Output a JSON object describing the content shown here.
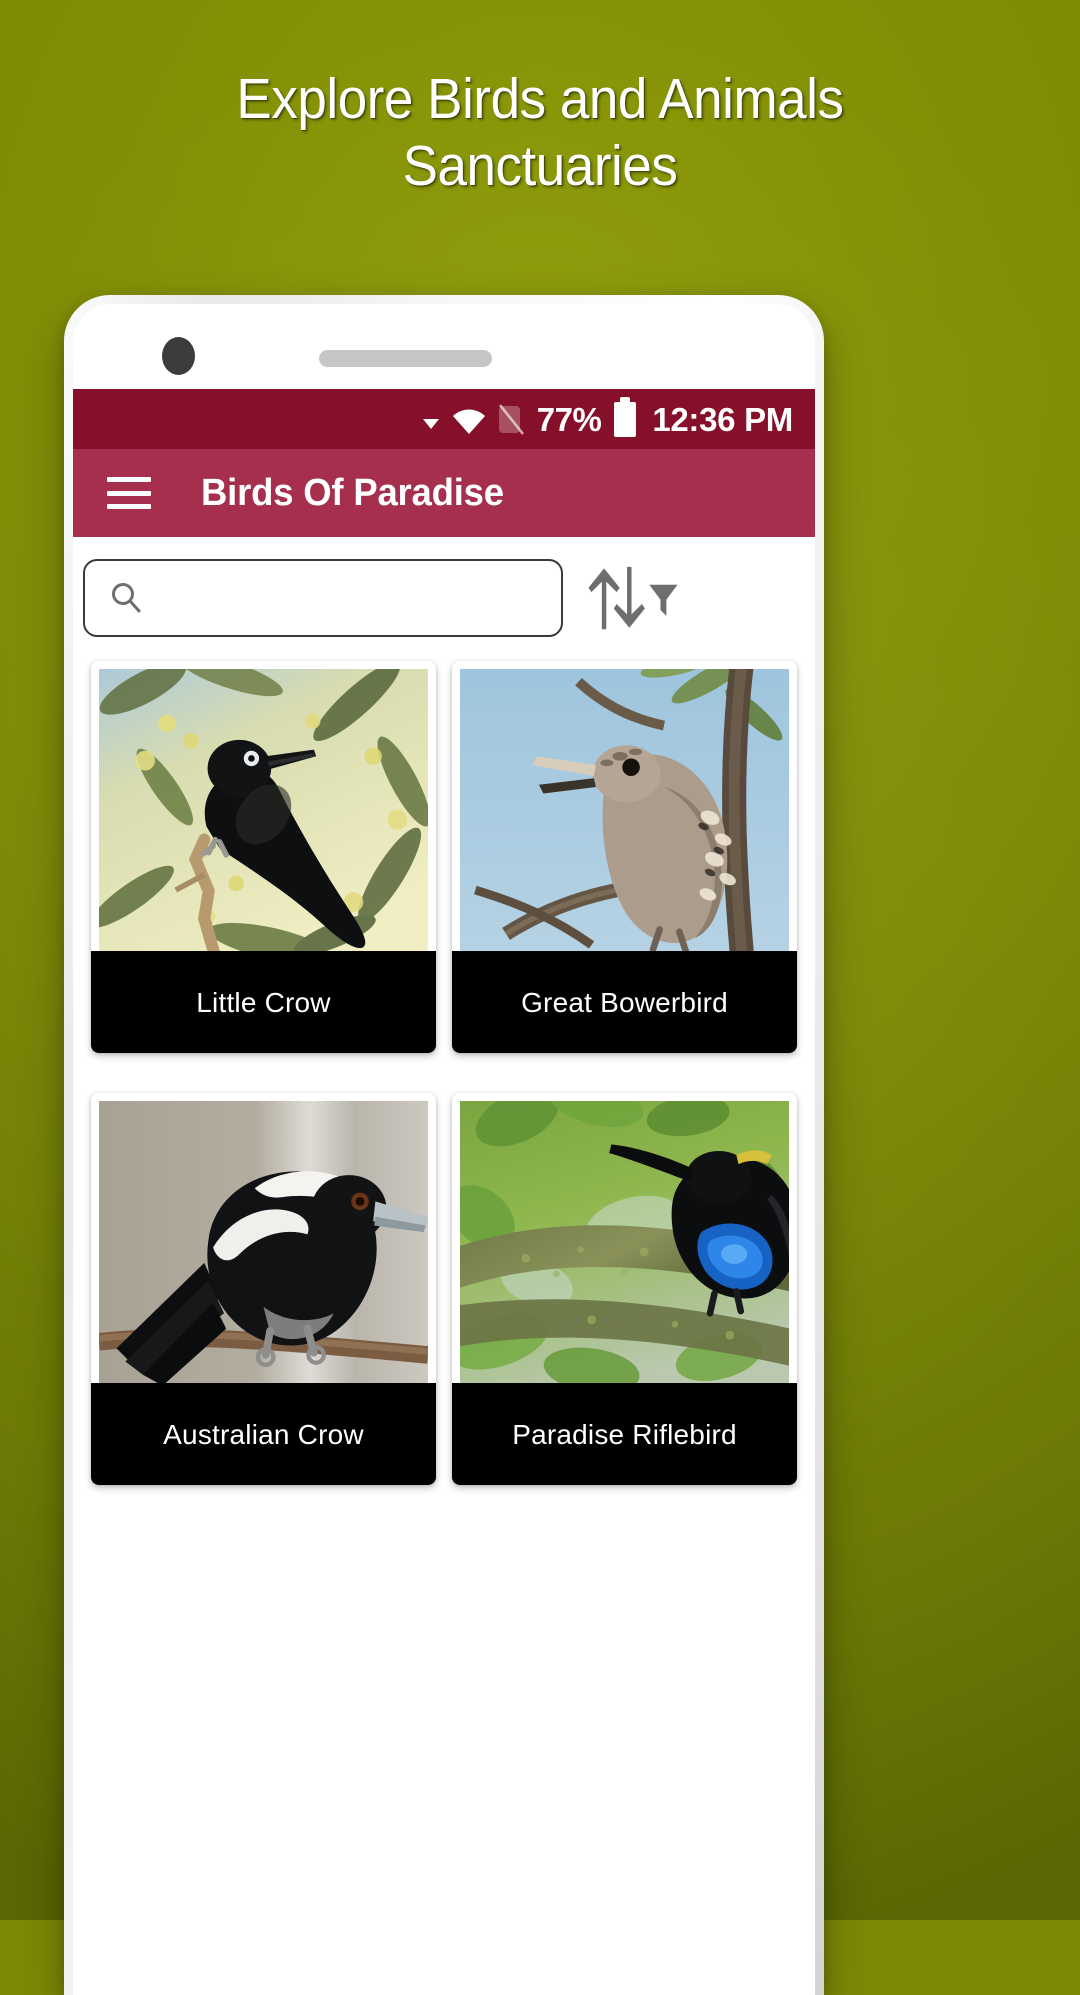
{
  "promo": {
    "headline": "Explore Birds and Animals\nSanctuaries",
    "background_color": "#7d8a06",
    "headline_color": "#ffffff"
  },
  "phone": {
    "frame_color": "#e9e9e9",
    "screen_color": "#ffffff"
  },
  "status_bar": {
    "background_color": "#861029",
    "text_color": "#ffffff",
    "battery_percent": "77%",
    "clock": "12:36 PM",
    "icons": [
      "caret-down-icon",
      "wifi-icon",
      "signal-off-icon",
      "battery-icon"
    ]
  },
  "app_bar": {
    "background_color": "#a52f4c",
    "menu_icon": "hamburger-menu-icon",
    "title": "Birds Of Paradise",
    "title_color": "#ffffff"
  },
  "search": {
    "value": "",
    "placeholder": "",
    "icon": "search-icon",
    "sort_icon": "sort-filter-icon"
  },
  "grid": {
    "label_background": "#000000",
    "label_color": "#ffffff",
    "items": [
      {
        "name": "Little Crow",
        "image_alt": "Black crow perched on a branch among yellow-green eucalyptus foliage"
      },
      {
        "name": "Great Bowerbird",
        "image_alt": "Tan bowerbird with open beak on a branch against a pale blue sky"
      },
      {
        "name": "Australian Crow",
        "image_alt": "Black and white magpie perched on a brown branch, grey background"
      },
      {
        "name": "Paradise Riflebird",
        "image_alt": "Black riflebird with blue iridescent breast on a mossy branch with green leaves"
      }
    ]
  }
}
